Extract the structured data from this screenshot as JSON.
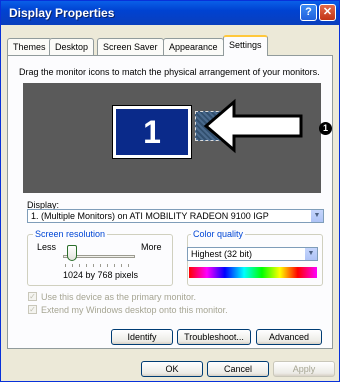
{
  "window": {
    "title": "Display Properties",
    "help_button": "?",
    "close_button": "✕"
  },
  "tabs": [
    {
      "label": "Themes",
      "active": false
    },
    {
      "label": "Desktop",
      "active": false
    },
    {
      "label": "Screen Saver",
      "active": false
    },
    {
      "label": "Appearance",
      "active": false
    },
    {
      "label": "Settings",
      "active": true
    }
  ],
  "settings": {
    "instruction": "Drag the monitor icons to match the physical arrangement of your monitors.",
    "monitor_primary_number": "1",
    "callout_number": "1",
    "display_label": "Display:",
    "display_value": "1. (Multiple Monitors) on ATI MOBILITY RADEON 9100 IGP",
    "screen_resolution": {
      "title": "Screen resolution",
      "less": "Less",
      "more": "More",
      "value_text": "1024 by 768 pixels",
      "slider_fraction": 0.1
    },
    "color_quality": {
      "title": "Color quality",
      "selected": "Highest (32 bit)"
    },
    "checkboxes": [
      {
        "label": "Use this device as the primary monitor.",
        "checked": true,
        "enabled": false
      },
      {
        "label": "Extend my Windows desktop onto this monitor.",
        "checked": true,
        "enabled": false
      }
    ],
    "buttons": {
      "identify": "Identify",
      "troubleshoot": "Troubleshoot...",
      "advanced": "Advanced"
    }
  },
  "footer": {
    "ok": "OK",
    "cancel": "Cancel",
    "apply": "Apply"
  },
  "colors": {
    "titlebar": "#0042d1",
    "monitor_area": "#5a5a5a",
    "primary_monitor": "#0a2a8a",
    "group_title": "#0046d5"
  }
}
